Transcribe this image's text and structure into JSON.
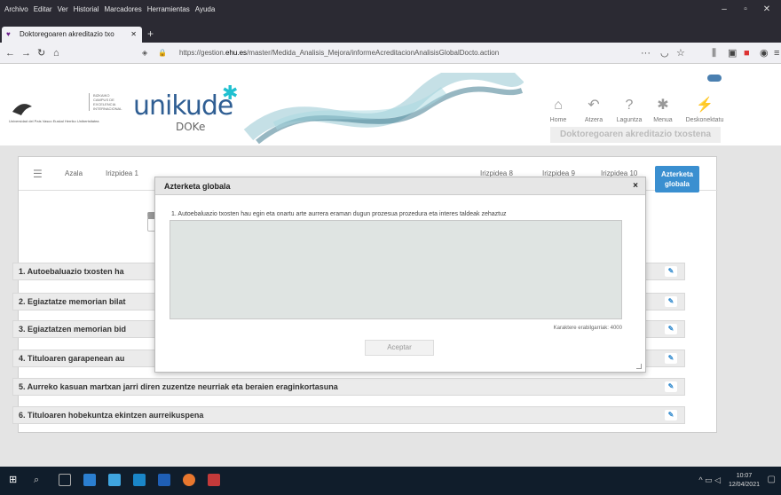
{
  "browser": {
    "menu": [
      "Archivo",
      "Editar",
      "Ver",
      "Historial",
      "Marcadores",
      "Herramientas",
      "Ayuda"
    ],
    "tab_title": "Doktoregoaren akreditazio txo",
    "url_pre": "https://gestion.",
    "url_host": "ehu.es",
    "url_post": "/master/Medida_Analisis_Mejora/informeAcreditacionAnalisisGlobalDocto.action",
    "more": "···"
  },
  "header": {
    "institution": "Universidad del País Vasco  Euskal Herriko Unibertsitatea",
    "campus": "BIZKAIKO CAMPUS DE EXCELENCIA INTERNACIONAL",
    "brand": "unikude",
    "brand_sub": "DOKe",
    "nav": [
      {
        "label": "Home",
        "icon": "⌂"
      },
      {
        "label": "Atzera",
        "icon": "↶"
      },
      {
        "label": "Laguntza",
        "icon": "?"
      },
      {
        "label": "Menua",
        "icon": "✱"
      },
      {
        "label": "Deskonektatu",
        "icon": "⚡"
      }
    ],
    "user_title": "Doktoregoaren akreditazio txostena"
  },
  "tabs": {
    "azala": "Azala",
    "irizpidea1": "Irizpidea 1",
    "irizpidea8": "Irizpidea 8",
    "irizpidea9": "Irizpidea 9",
    "irizpidea10": "Irizpidea 10",
    "active_line1": "Azterketa",
    "active_line2": "globala"
  },
  "rows": [
    "1. Autoebaluazio txosten ha",
    "2. Egiaztatze memorian bilat",
    "3. Egiaztatzen memorian bid",
    "4. Tituloaren garapenean au",
    "5. Aurreko kasuan martxan jarri diren zuzentze neurriak eta beraien eraginkortasuna",
    "6. Tituloaren hobekuntza ekintzen aurreikuspena"
  ],
  "modal": {
    "title": "Azterketa globala",
    "close": "×",
    "question": "1. Autoebaluazio txosten hau egin eta onartu arte aurrera eraman dugun prozesua prozedura eta interes taldeak zehaztuz",
    "answer": "",
    "counter": "Karaktere erabilgarriak: 4000",
    "accept": "Aceptar"
  },
  "taskbar": {
    "time": "10:07",
    "date": "12/04/2021"
  }
}
